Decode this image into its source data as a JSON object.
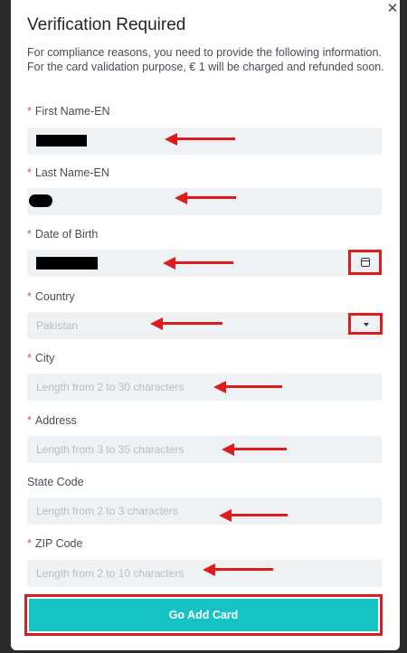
{
  "modal": {
    "title": "Verification Required",
    "description": "For compliance reasons, you need to provide the following information. For the card validation purpose, € 1 will be charged and refunded soon.",
    "close_icon": "close-icon"
  },
  "fields": {
    "first_name": {
      "label": "First Name-EN",
      "required": "*",
      "value": ""
    },
    "last_name": {
      "label": "Last Name-EN",
      "required": "*",
      "value": ""
    },
    "dob": {
      "label": "Date of Birth",
      "required": "*",
      "value": "",
      "icon": "calendar-icon"
    },
    "country": {
      "label": "Country",
      "required": "*",
      "value": "Pakistan",
      "icon": "chevron-down-icon"
    },
    "city": {
      "label": "City",
      "required": "*",
      "placeholder": "Length from 2 to 30 characters"
    },
    "address": {
      "label": "Address",
      "required": "*",
      "placeholder": "Length from 3 to 35 characters"
    },
    "state_code": {
      "label": "State Code",
      "placeholder": "Length from 2 to 3 characters"
    },
    "zip_code": {
      "label": "ZIP Code",
      "required": "*",
      "placeholder": "Length from 2 to 10 characters"
    }
  },
  "actions": {
    "submit_label": "Go Add Card"
  },
  "colors": {
    "accent": "#15c3c3",
    "annotation": "#dd1c1c",
    "required": "#e84b4b"
  }
}
